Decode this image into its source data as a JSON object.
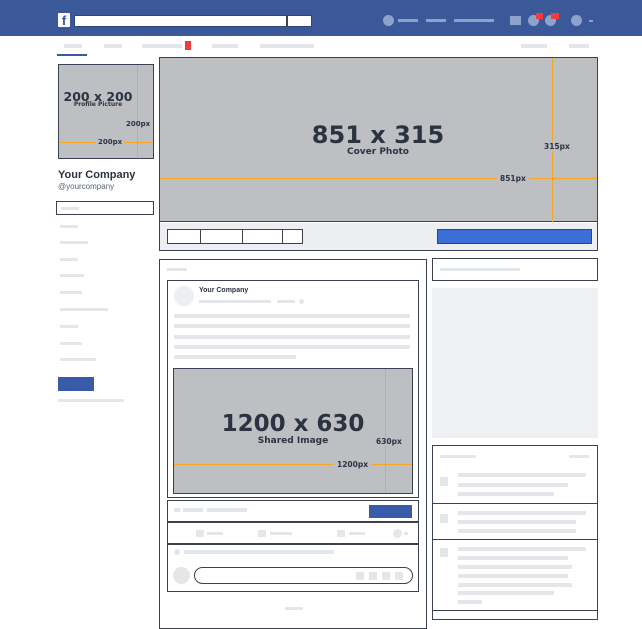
{
  "topbar": {
    "logo": "f",
    "search_placeholder": ""
  },
  "profile_picture": {
    "size": "200 x 200",
    "label": "Profile Picture",
    "width_dim": "200px",
    "height_dim": "200px"
  },
  "page": {
    "name": "Your Company",
    "handle": "@yourcompany"
  },
  "cover_photo": {
    "size": "851 x 315",
    "label": "Cover Photo",
    "width_dim": "851px",
    "height_dim": "315px"
  },
  "post": {
    "author": "Your Company"
  },
  "shared_image": {
    "size": "1200 x 630",
    "label": "Shared Image",
    "width_dim": "1200px",
    "height_dim": "630px"
  },
  "colors": {
    "brand": "#3b5998",
    "accent": "#f5a623",
    "button": "#3b6fd6",
    "notification": "#f23b3b"
  }
}
